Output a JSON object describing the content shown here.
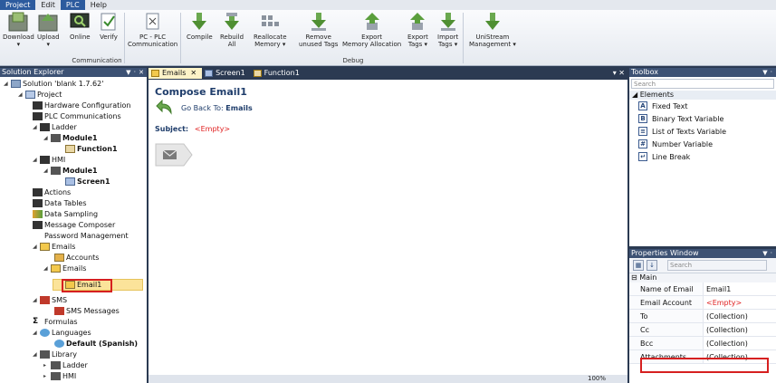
{
  "menu": {
    "tabs": [
      "Project",
      "Edit",
      "PLC",
      "Help"
    ]
  },
  "ribbon": {
    "buttons": [
      {
        "label": "Download",
        "sub": "▾"
      },
      {
        "label": "Upload",
        "sub": "▾"
      },
      {
        "label": "Online",
        "sub": ""
      },
      {
        "label": "Verify",
        "sub": ""
      },
      {
        "label": "PC - PLC",
        "sub": "Communication"
      },
      {
        "label": "Compile",
        "sub": ""
      },
      {
        "label": "Rebuild",
        "sub": "All"
      },
      {
        "label": "Reallocate",
        "sub": "Memory ▾"
      },
      {
        "label": "Remove",
        "sub": "unused Tags"
      },
      {
        "label": "Export",
        "sub": "Memory Allocation"
      },
      {
        "label": "Export",
        "sub": "Tags ▾"
      },
      {
        "label": "Import",
        "sub": "Tags ▾"
      },
      {
        "label": "UniStream",
        "sub": "Management ▾"
      }
    ],
    "groups": [
      "Communication",
      "Debug"
    ]
  },
  "solution_explorer": {
    "title": "Solution Explorer",
    "pin": "▼ ᛫ ✕",
    "nodes": [
      {
        "label": "Solution 'blank 1.7.62'",
        "exp": "◢"
      },
      {
        "label": "Project",
        "exp": "◢"
      },
      {
        "label": "Hardware Configuration",
        "exp": ""
      },
      {
        "label": "PLC Communications",
        "exp": ""
      },
      {
        "label": "Ladder",
        "exp": "◢"
      },
      {
        "label": "Module1",
        "exp": "◢"
      },
      {
        "label": "Function1",
        "exp": ""
      },
      {
        "label": "HMI",
        "exp": "◢"
      },
      {
        "label": "Module1",
        "exp": "◢"
      },
      {
        "label": "Screen1",
        "exp": ""
      },
      {
        "label": "Actions",
        "exp": ""
      },
      {
        "label": "Data Tables",
        "exp": ""
      },
      {
        "label": "Data Sampling",
        "exp": ""
      },
      {
        "label": "Message Composer",
        "exp": ""
      },
      {
        "label": "Password Management",
        "exp": ""
      },
      {
        "label": "Emails",
        "exp": "◢"
      },
      {
        "label": "Accounts",
        "exp": ""
      },
      {
        "label": "Emails",
        "exp": "◢"
      },
      {
        "label": "Email1",
        "exp": ""
      },
      {
        "label": "SMS",
        "exp": "◢"
      },
      {
        "label": "SMS Messages",
        "exp": ""
      },
      {
        "label": "Formulas",
        "exp": ""
      },
      {
        "label": "Languages",
        "exp": "◢"
      },
      {
        "label": "Default (Spanish)",
        "exp": ""
      },
      {
        "label": "Library",
        "exp": "◢"
      },
      {
        "label": "Ladder",
        "exp": "▸"
      },
      {
        "label": "HMI",
        "exp": "▸"
      }
    ]
  },
  "document": {
    "tabs": [
      {
        "label": "Emails",
        "close": "✕"
      },
      {
        "label": "Screen1",
        "close": ""
      },
      {
        "label": "Function1",
        "close": ""
      }
    ],
    "tab_controls": "▾ ✕",
    "title": "Compose Email1",
    "goback_label": "Go Back To:",
    "goback_target": "Emails",
    "subject_label": "Subject:",
    "subject_value": "<Empty>",
    "zoom": "100%"
  },
  "toolbox": {
    "title": "Toolbox",
    "pin": "▼ ᛫",
    "search_placeholder": "Search",
    "section": "Elements",
    "items": [
      {
        "label": "Fixed Text",
        "icon": "A"
      },
      {
        "label": "Binary Text Variable",
        "icon": "B"
      },
      {
        "label": "List of Texts Variable",
        "icon": "≡"
      },
      {
        "label": "Number Variable",
        "icon": "#"
      },
      {
        "label": "Line Break",
        "icon": "↵"
      }
    ]
  },
  "properties": {
    "title": "Properties Window",
    "pin": "▼ ᛫",
    "search_placeholder": "Search",
    "section": "Main",
    "rows": [
      {
        "key": "Name of Email",
        "value": "Email1",
        "red": false
      },
      {
        "key": "Email Account",
        "value": "<Empty>",
        "red": true
      },
      {
        "key": "To",
        "value": "(Collection)",
        "red": false
      },
      {
        "key": "Cc",
        "value": "(Collection)",
        "red": false
      },
      {
        "key": "Bcc",
        "value": "(Collection)",
        "red": false
      },
      {
        "key": "Attachments",
        "value": "(Collection)",
        "red": false
      }
    ]
  },
  "colors": {
    "accent": "#2c5b9e",
    "panel_title": "#3d5274",
    "highlight": "#d62020"
  }
}
